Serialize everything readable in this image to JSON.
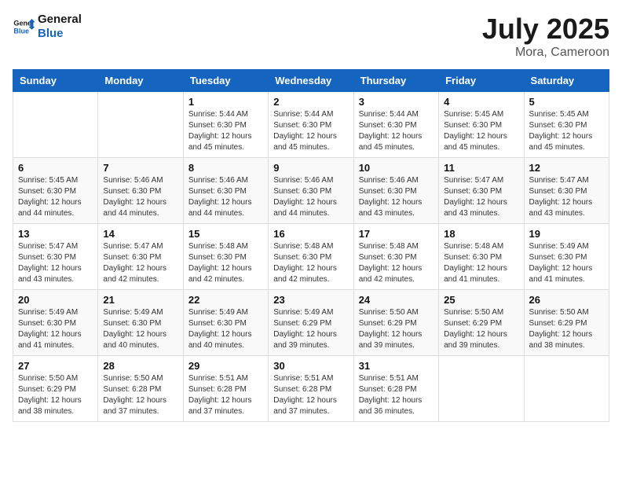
{
  "logo": {
    "line1": "General",
    "line2": "Blue"
  },
  "title": "July 2025",
  "location": "Mora, Cameroon",
  "headers": [
    "Sunday",
    "Monday",
    "Tuesday",
    "Wednesday",
    "Thursday",
    "Friday",
    "Saturday"
  ],
  "weeks": [
    [
      {
        "day": "",
        "info": ""
      },
      {
        "day": "",
        "info": ""
      },
      {
        "day": "1",
        "info": "Sunrise: 5:44 AM\nSunset: 6:30 PM\nDaylight: 12 hours and 45 minutes."
      },
      {
        "day": "2",
        "info": "Sunrise: 5:44 AM\nSunset: 6:30 PM\nDaylight: 12 hours and 45 minutes."
      },
      {
        "day": "3",
        "info": "Sunrise: 5:44 AM\nSunset: 6:30 PM\nDaylight: 12 hours and 45 minutes."
      },
      {
        "day": "4",
        "info": "Sunrise: 5:45 AM\nSunset: 6:30 PM\nDaylight: 12 hours and 45 minutes."
      },
      {
        "day": "5",
        "info": "Sunrise: 5:45 AM\nSunset: 6:30 PM\nDaylight: 12 hours and 45 minutes."
      }
    ],
    [
      {
        "day": "6",
        "info": "Sunrise: 5:45 AM\nSunset: 6:30 PM\nDaylight: 12 hours and 44 minutes."
      },
      {
        "day": "7",
        "info": "Sunrise: 5:46 AM\nSunset: 6:30 PM\nDaylight: 12 hours and 44 minutes."
      },
      {
        "day": "8",
        "info": "Sunrise: 5:46 AM\nSunset: 6:30 PM\nDaylight: 12 hours and 44 minutes."
      },
      {
        "day": "9",
        "info": "Sunrise: 5:46 AM\nSunset: 6:30 PM\nDaylight: 12 hours and 44 minutes."
      },
      {
        "day": "10",
        "info": "Sunrise: 5:46 AM\nSunset: 6:30 PM\nDaylight: 12 hours and 43 minutes."
      },
      {
        "day": "11",
        "info": "Sunrise: 5:47 AM\nSunset: 6:30 PM\nDaylight: 12 hours and 43 minutes."
      },
      {
        "day": "12",
        "info": "Sunrise: 5:47 AM\nSunset: 6:30 PM\nDaylight: 12 hours and 43 minutes."
      }
    ],
    [
      {
        "day": "13",
        "info": "Sunrise: 5:47 AM\nSunset: 6:30 PM\nDaylight: 12 hours and 43 minutes."
      },
      {
        "day": "14",
        "info": "Sunrise: 5:47 AM\nSunset: 6:30 PM\nDaylight: 12 hours and 42 minutes."
      },
      {
        "day": "15",
        "info": "Sunrise: 5:48 AM\nSunset: 6:30 PM\nDaylight: 12 hours and 42 minutes."
      },
      {
        "day": "16",
        "info": "Sunrise: 5:48 AM\nSunset: 6:30 PM\nDaylight: 12 hours and 42 minutes."
      },
      {
        "day": "17",
        "info": "Sunrise: 5:48 AM\nSunset: 6:30 PM\nDaylight: 12 hours and 42 minutes."
      },
      {
        "day": "18",
        "info": "Sunrise: 5:48 AM\nSunset: 6:30 PM\nDaylight: 12 hours and 41 minutes."
      },
      {
        "day": "19",
        "info": "Sunrise: 5:49 AM\nSunset: 6:30 PM\nDaylight: 12 hours and 41 minutes."
      }
    ],
    [
      {
        "day": "20",
        "info": "Sunrise: 5:49 AM\nSunset: 6:30 PM\nDaylight: 12 hours and 41 minutes."
      },
      {
        "day": "21",
        "info": "Sunrise: 5:49 AM\nSunset: 6:30 PM\nDaylight: 12 hours and 40 minutes."
      },
      {
        "day": "22",
        "info": "Sunrise: 5:49 AM\nSunset: 6:30 PM\nDaylight: 12 hours and 40 minutes."
      },
      {
        "day": "23",
        "info": "Sunrise: 5:49 AM\nSunset: 6:29 PM\nDaylight: 12 hours and 39 minutes."
      },
      {
        "day": "24",
        "info": "Sunrise: 5:50 AM\nSunset: 6:29 PM\nDaylight: 12 hours and 39 minutes."
      },
      {
        "day": "25",
        "info": "Sunrise: 5:50 AM\nSunset: 6:29 PM\nDaylight: 12 hours and 39 minutes."
      },
      {
        "day": "26",
        "info": "Sunrise: 5:50 AM\nSunset: 6:29 PM\nDaylight: 12 hours and 38 minutes."
      }
    ],
    [
      {
        "day": "27",
        "info": "Sunrise: 5:50 AM\nSunset: 6:29 PM\nDaylight: 12 hours and 38 minutes."
      },
      {
        "day": "28",
        "info": "Sunrise: 5:50 AM\nSunset: 6:28 PM\nDaylight: 12 hours and 37 minutes."
      },
      {
        "day": "29",
        "info": "Sunrise: 5:51 AM\nSunset: 6:28 PM\nDaylight: 12 hours and 37 minutes."
      },
      {
        "day": "30",
        "info": "Sunrise: 5:51 AM\nSunset: 6:28 PM\nDaylight: 12 hours and 37 minutes."
      },
      {
        "day": "31",
        "info": "Sunrise: 5:51 AM\nSunset: 6:28 PM\nDaylight: 12 hours and 36 minutes."
      },
      {
        "day": "",
        "info": ""
      },
      {
        "day": "",
        "info": ""
      }
    ]
  ]
}
